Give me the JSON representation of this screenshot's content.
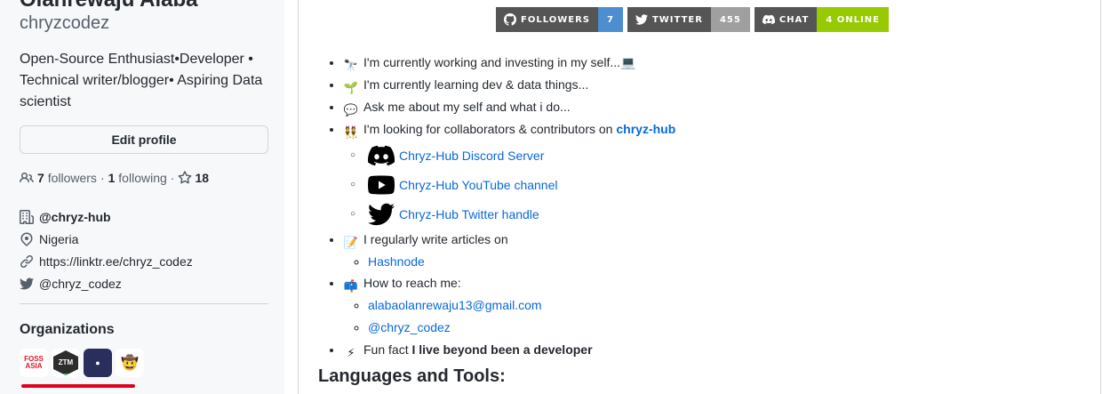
{
  "profile": {
    "fullname": "Olanrewaju Alaba",
    "username": "chryzcodez",
    "bio": "Open-Source Enthusiast•Developer • Technical writer/blogger• Aspiring Data scientist",
    "edit_label": "Edit profile",
    "followers_count": "7",
    "followers_label": "followers",
    "sep": "·",
    "following_count": "1",
    "following_label": "following",
    "sep2": "·",
    "stars_count": "18",
    "details": {
      "company": "@chryz-hub",
      "location": "Nigeria",
      "website": "https://linktr.ee/chryz_codez",
      "twitter": "@chryz_codez"
    },
    "organizations_title": "Organizations",
    "org_fossasia": "FOSS ASIA",
    "org_ztm": "ZTM"
  },
  "badges": {
    "followers_label": "FOLLOWERS",
    "followers_value": "7",
    "followers_color": "#4c8ed0",
    "twitter_label": "TWITTER",
    "twitter_value": "455",
    "twitter_color": "#9f9f9f",
    "chat_label": "CHAT",
    "chat_value": "4 ONLINE",
    "chat_color": "#97ca00"
  },
  "readme": {
    "items": [
      {
        "emoji": "🔭",
        "text": "I'm currently working and investing in my self...",
        "suffix": "💻"
      },
      {
        "emoji": "🌱",
        "text": "I'm currently learning dev & data things..."
      },
      {
        "emoji": "💬",
        "text": "Ask me about my self and what i do..."
      },
      {
        "emoji": "👯",
        "text": "I'm looking for collaborators & contributors on ",
        "link": "chryz-hub"
      }
    ],
    "social_links": {
      "discord": "Chryz-Hub Discord Server",
      "youtube": "Chryz-Hub YouTube channel",
      "twitter": "Chryz-Hub Twitter handle"
    },
    "articles": {
      "emoji": "📝",
      "text": "I regularly write articles on",
      "link": "Hashnode"
    },
    "reach": {
      "emoji": "📫",
      "text": "How to reach me:",
      "email": "alabaolanrewaju13@gmail.com",
      "twitter": "@chryz_codez"
    },
    "fun_fact": {
      "emoji": "⚡",
      "prefix": "Fun fact ",
      "bold": "I live beyond been a developer"
    },
    "languages_title": "Languages and Tools:"
  }
}
